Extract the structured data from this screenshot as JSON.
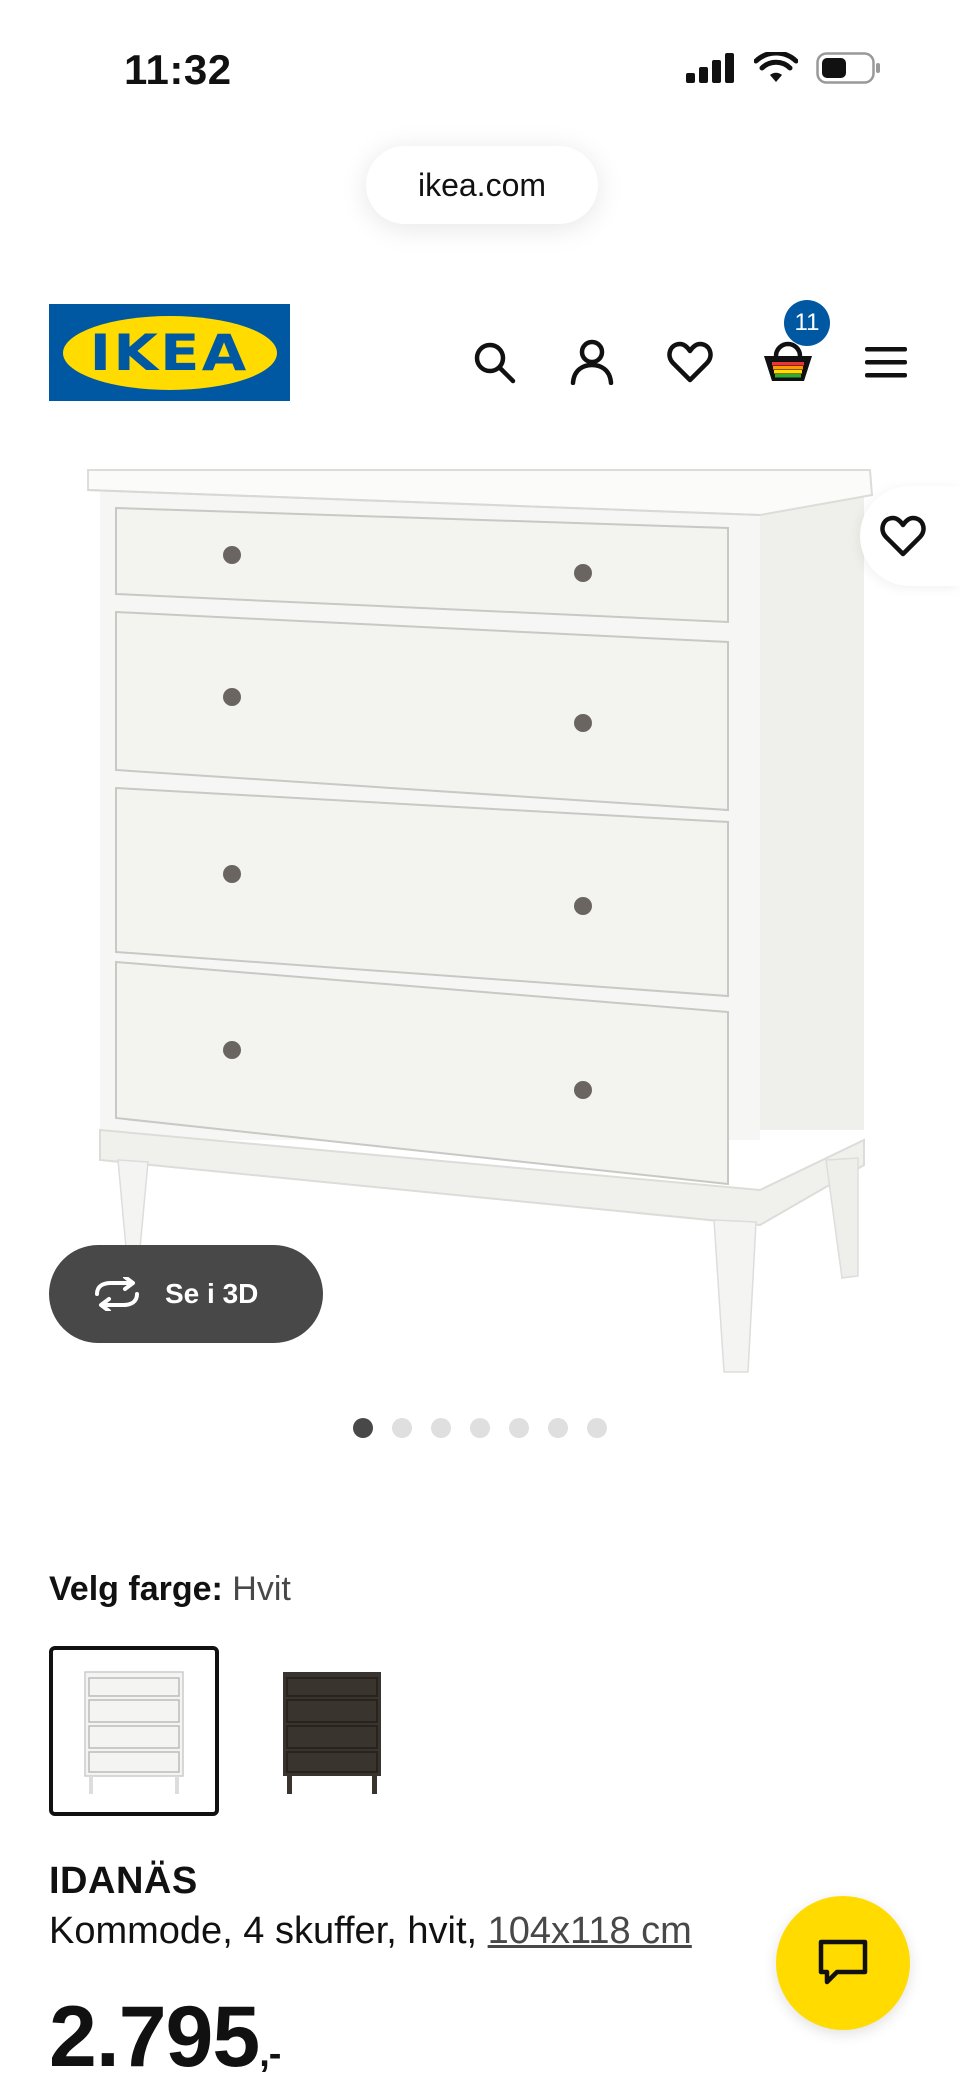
{
  "status_bar": {
    "time": "11:32",
    "battery_level": 0.4
  },
  "browser": {
    "url": "ikea.com"
  },
  "header": {
    "logo_text": "IKEA",
    "cart_count": "11",
    "icons": [
      "search-icon",
      "account-icon",
      "heart-icon",
      "cart-icon",
      "menu-icon"
    ]
  },
  "gallery": {
    "view_3d_label": "Se i 3D",
    "image_count": 7,
    "active_index": 0
  },
  "color_selector": {
    "label": "Velg farge:",
    "selected_value": "Hvit",
    "options": [
      {
        "name": "Hvit",
        "color": "#f2f2ef",
        "selected": true
      },
      {
        "name": "dark",
        "color": "#3a342e",
        "selected": false
      }
    ]
  },
  "product": {
    "name": "IDANÄS",
    "description": "Kommode, 4 skuffer, hvit, ",
    "dimensions": "104x118 cm",
    "price": "2.795",
    "price_suffix": ",-"
  },
  "colors": {
    "ikea_blue": "#0058a3",
    "ikea_yellow": "#ffdb00"
  }
}
